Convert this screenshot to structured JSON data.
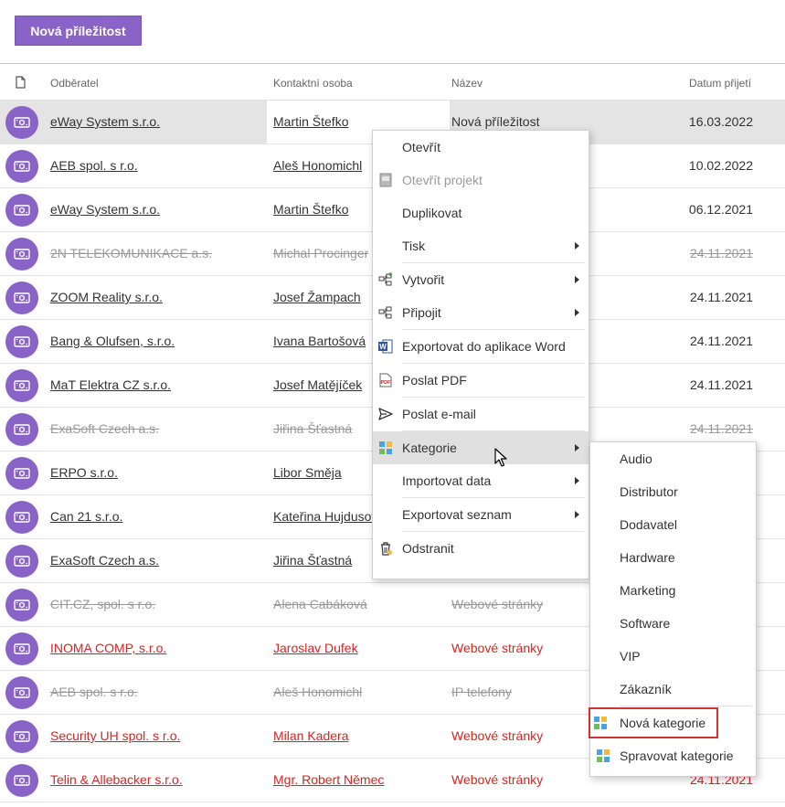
{
  "toolbar": {
    "new_button": "Nová příležitost"
  },
  "columns": {
    "customer": "Odběratel",
    "contact": "Kontaktní osoba",
    "name": "Název",
    "date": "Datum přijetí"
  },
  "rows": [
    {
      "customer": "eWay System s.r.o.",
      "contact": "Martin Štefko",
      "name": "Nová příležitost",
      "date": "16.03.2022",
      "state": "selected"
    },
    {
      "customer": "AEB spol. s r.o.",
      "contact": "Aleš Honomichl",
      "name": "",
      "date": "10.02.2022",
      "state": "normal"
    },
    {
      "customer": "eWay System s.r.o.",
      "contact": "Martin Štefko",
      "name": "",
      "date": "06.12.2021",
      "state": "normal"
    },
    {
      "customer": "2N TELEKOMUNIKACE a.s.",
      "contact": "Michal Procinger",
      "name": "",
      "date": "24.11.2021",
      "state": "struck"
    },
    {
      "customer": "ZOOM Reality s.r.o.",
      "contact": "Josef Žampach",
      "name": "",
      "date": "24.11.2021",
      "state": "normal"
    },
    {
      "customer": "Bang & Olufsen, s.r.o.",
      "contact": "Ivana Bartošová",
      "name": "",
      "date": "24.11.2021",
      "state": "normal"
    },
    {
      "customer": "MaT Elektra CZ s.r.o.",
      "contact": "Josef Matějíček",
      "name": "",
      "date": "24.11.2021",
      "state": "normal"
    },
    {
      "customer": "ExaSoft Czech a.s.",
      "contact": "Jiřina Šťastná",
      "name": "",
      "date": "24.11.2021",
      "state": "struck"
    },
    {
      "customer": "ERPO s.r.o.",
      "contact": "Libor Směja",
      "name": "",
      "date": "",
      "state": "normal"
    },
    {
      "customer": "Can 21 s.r.o.",
      "contact": "Kateřina Hujdusov",
      "name": "",
      "date": "",
      "state": "normal"
    },
    {
      "customer": "ExaSoft Czech a.s.",
      "contact": "Jiřina Šťastná",
      "name": "",
      "date": "",
      "state": "normal"
    },
    {
      "customer": "CIT.CZ, spol. s r.o.",
      "contact": "Alena Cabáková",
      "name": "Webové stránky",
      "date": "",
      "state": "struck"
    },
    {
      "customer": "INOMA COMP, s.r.o.",
      "contact": "Jaroslav Dufek",
      "name": "Webové stránky",
      "date": "",
      "state": "red"
    },
    {
      "customer": "AEB spol. s r.o.",
      "contact": "Aleš Honomichl",
      "name": "IP telefony",
      "date": "",
      "state": "struck"
    },
    {
      "customer": "Security UH spol. s r.o.",
      "contact": "Milan Kadera",
      "name": "Webové stránky",
      "date": "",
      "state": "red"
    },
    {
      "customer": "Telin & Allebacker s.r.o.",
      "contact": "Mgr. Robert Němec",
      "name": "Webové stránky",
      "date": "24.11.2021",
      "state": "red"
    }
  ],
  "context_menu": {
    "items": [
      {
        "label": "Otevřít",
        "icon": "",
        "arrow": false,
        "disabled": false
      },
      {
        "label": "Otevřít projekt",
        "icon": "project-icon",
        "arrow": false,
        "disabled": true
      },
      {
        "label": "Duplikovat",
        "icon": "",
        "arrow": false,
        "disabled": false
      },
      {
        "label": "Tisk",
        "icon": "",
        "arrow": true,
        "disabled": false,
        "sep_after": true
      },
      {
        "label": "Vytvořit",
        "icon": "create-icon",
        "arrow": true,
        "disabled": false
      },
      {
        "label": "Připojit",
        "icon": "attach-icon",
        "arrow": true,
        "disabled": false,
        "sep_after": true
      },
      {
        "label": "Exportovat do aplikace Word",
        "icon": "word-icon",
        "arrow": false,
        "disabled": false,
        "sep_after": true
      },
      {
        "label": "Poslat PDF",
        "icon": "pdf-icon",
        "arrow": false,
        "disabled": false,
        "sep_after": true
      },
      {
        "label": "Poslat e-mail",
        "icon": "send-icon",
        "arrow": false,
        "disabled": false,
        "sep_after": true
      },
      {
        "label": "Kategorie",
        "icon": "category-icon",
        "arrow": true,
        "disabled": false,
        "hover": true
      },
      {
        "label": "Importovat data",
        "icon": "",
        "arrow": true,
        "disabled": false,
        "sep_after": true
      },
      {
        "label": "Exportovat seznam",
        "icon": "",
        "arrow": true,
        "disabled": false,
        "sep_after": true
      },
      {
        "label": "Odstranit",
        "icon": "delete-icon",
        "arrow": false,
        "disabled": false
      }
    ]
  },
  "category_submenu": {
    "categories": [
      "Audio",
      "Distributor",
      "Dodavatel",
      "Hardware",
      "Marketing",
      "Software",
      "VIP",
      "Zákazník"
    ],
    "new_category": "Nová kategorie",
    "manage_categories": "Spravovat kategorie"
  },
  "colors": {
    "accent": "#8a63c6",
    "red": "#d62424",
    "highlight_outline": "#d63030"
  }
}
